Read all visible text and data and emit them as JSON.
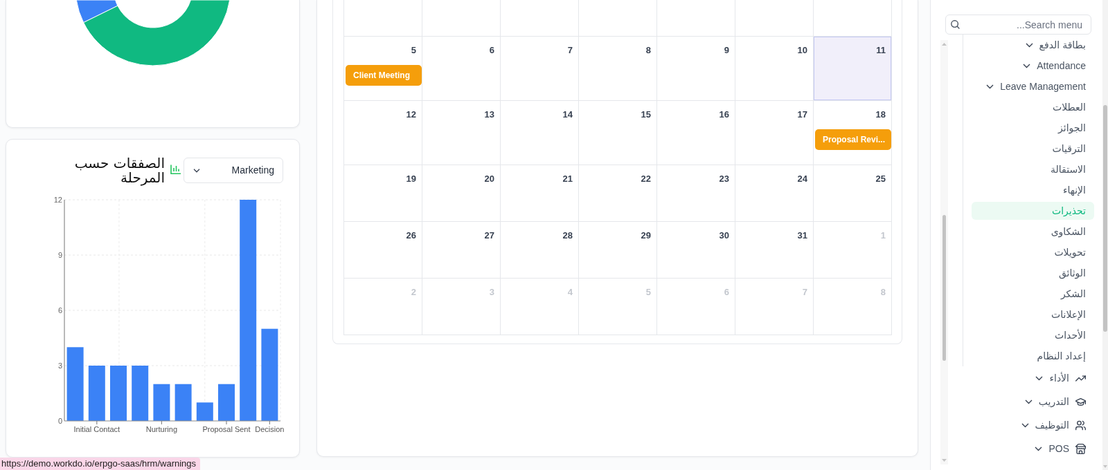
{
  "donut_chart": {
    "slices": [
      {
        "color": "#3b82f6"
      },
      {
        "color": "#10b981"
      }
    ]
  },
  "deals_card": {
    "title": "الصفقات حسب المرحلة",
    "filter": {
      "value": "Marketing"
    },
    "chart_data": {
      "type": "bar",
      "categories": [
        null,
        "Initial Contact",
        null,
        null,
        "Nurturing",
        null,
        null,
        "Proposal Sent",
        null,
        "Decision"
      ],
      "values": [
        4,
        3,
        3,
        3,
        2,
        2,
        1,
        2,
        12,
        5
      ],
      "ylim": [
        0,
        12
      ],
      "yticks": [
        0,
        3,
        6,
        9,
        12
      ],
      "grid": true
    }
  },
  "calendar": {
    "weeks": [
      {
        "days": [
          {
            "day": "11",
            "other_month": false,
            "today": true
          },
          {
            "day": "10",
            "other_month": false,
            "today": false
          },
          {
            "day": "9",
            "other_month": false,
            "today": false
          },
          {
            "day": "8",
            "other_month": false,
            "today": false
          },
          {
            "day": "7",
            "other_month": false,
            "today": false
          },
          {
            "day": "6",
            "other_month": false,
            "today": false
          },
          {
            "day": "5",
            "other_month": false,
            "today": false,
            "events": [
              {
                "title": "Client Meeting"
              }
            ]
          }
        ]
      },
      {
        "days": [
          {
            "day": "18",
            "other_month": false,
            "today": false,
            "events": [
              {
                "title": "Proposal Revi..."
              }
            ]
          },
          {
            "day": "17",
            "other_month": false,
            "today": false
          },
          {
            "day": "16",
            "other_month": false,
            "today": false
          },
          {
            "day": "15",
            "other_month": false,
            "today": false
          },
          {
            "day": "14",
            "other_month": false,
            "today": false
          },
          {
            "day": "13",
            "other_month": false,
            "today": false
          },
          {
            "day": "12",
            "other_month": false,
            "today": false
          }
        ]
      },
      {
        "days": [
          {
            "day": "25",
            "other_month": false,
            "today": false
          },
          {
            "day": "24",
            "other_month": false,
            "today": false
          },
          {
            "day": "23",
            "other_month": false,
            "today": false
          },
          {
            "day": "22",
            "other_month": false,
            "today": false
          },
          {
            "day": "21",
            "other_month": false,
            "today": false
          },
          {
            "day": "20",
            "other_month": false,
            "today": false
          },
          {
            "day": "19",
            "other_month": false,
            "today": false
          }
        ]
      },
      {
        "days": [
          {
            "day": "1",
            "other_month": true,
            "today": false
          },
          {
            "day": "31",
            "other_month": false,
            "today": false
          },
          {
            "day": "30",
            "other_month": false,
            "today": false
          },
          {
            "day": "29",
            "other_month": false,
            "today": false
          },
          {
            "day": "28",
            "other_month": false,
            "today": false
          },
          {
            "day": "27",
            "other_month": false,
            "today": false
          },
          {
            "day": "26",
            "other_month": false,
            "today": false
          }
        ]
      },
      {
        "days": [
          {
            "day": "8",
            "other_month": true,
            "today": false
          },
          {
            "day": "7",
            "other_month": true,
            "today": false
          },
          {
            "day": "6",
            "other_month": true,
            "today": false
          },
          {
            "day": "5",
            "other_month": true,
            "today": false
          },
          {
            "day": "4",
            "other_month": true,
            "today": false
          },
          {
            "day": "3",
            "other_month": true,
            "today": false
          },
          {
            "day": "2",
            "other_month": true,
            "today": false
          }
        ]
      }
    ]
  },
  "sidebar": {
    "search": {
      "placeholder": "...Search menu"
    },
    "submenu": [
      {
        "label": "بطاقة الدفع",
        "kind": "group",
        "selected": false
      },
      {
        "label": "Attendance",
        "kind": "group",
        "selected": false
      },
      {
        "label": "Leave Management",
        "kind": "group",
        "selected": false
      },
      {
        "label": "العطلات",
        "kind": "link",
        "selected": false
      },
      {
        "label": "الجوائز",
        "kind": "link",
        "selected": false
      },
      {
        "label": "الترقيات",
        "kind": "link",
        "selected": false
      },
      {
        "label": "الاستقالة",
        "kind": "link",
        "selected": false
      },
      {
        "label": "الإنهاء",
        "kind": "link",
        "selected": false
      },
      {
        "label": "تحذيرات",
        "kind": "link",
        "selected": true
      },
      {
        "label": "الشكاوى",
        "kind": "link",
        "selected": false
      },
      {
        "label": "تحويلات",
        "kind": "link",
        "selected": false
      },
      {
        "label": "الوثائق",
        "kind": "link",
        "selected": false
      },
      {
        "label": "الشكر",
        "kind": "link",
        "selected": false
      },
      {
        "label": "الإعلانات",
        "kind": "link",
        "selected": false
      },
      {
        "label": "الأحداث",
        "kind": "link",
        "selected": false
      },
      {
        "label": "إعداد النظام",
        "kind": "link",
        "selected": false
      }
    ],
    "menu": [
      {
        "label": "الأداء",
        "kind": "group",
        "selected": false
      },
      {
        "label": "التدريب",
        "kind": "group",
        "selected": false
      },
      {
        "label": "التوظيف",
        "kind": "group",
        "selected": false
      },
      {
        "label": "POS",
        "kind": "group",
        "selected": false
      }
    ]
  },
  "status_url": "https://demo.workdo.io/erpgo-saas/hrm/warnings"
}
